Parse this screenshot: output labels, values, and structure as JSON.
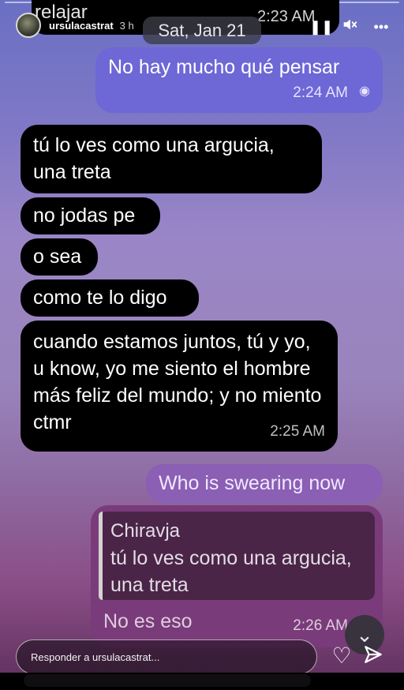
{
  "header": {
    "username": "ursulacastrat",
    "time_ago": "3 h",
    "controls": [
      {
        "icon": "pause-icon",
        "symbol": "❚❚"
      },
      {
        "icon": "mute-icon",
        "symbol": "🔇"
      },
      {
        "icon": "more-icon",
        "symbol": "•••"
      }
    ]
  },
  "chat": {
    "cutoff_top_text": "relajar",
    "cutoff_top_time": "2:23 AM",
    "date_pill": "Sat, Jan 21",
    "messages": [
      {
        "id": "m1",
        "direction": "out",
        "text": "No hay mucho qué pensar",
        "time": "2:24 AM",
        "status_icon": "read-check-icon"
      },
      {
        "id": "m2",
        "direction": "in",
        "text": "tú lo ves como una argucia, una treta"
      },
      {
        "id": "m3",
        "direction": "in",
        "text": "no jodas pe"
      },
      {
        "id": "m4",
        "direction": "in",
        "text": "o sea"
      },
      {
        "id": "m5",
        "direction": "in",
        "text": "como te lo digo"
      },
      {
        "id": "m6",
        "direction": "in",
        "text": "cuando estamos juntos, tú y yo, u know, yo me siento el hombre más feliz del mundo; y no miento ctmr",
        "time": "2:25 AM"
      },
      {
        "id": "m7",
        "direction": "out",
        "text": "Who is swearing now"
      },
      {
        "id": "m8",
        "direction": "out",
        "text": "No es eso",
        "time": "2:26 AM",
        "quote": {
          "name": "Chiravja",
          "text": "tú lo ves como una argucia, una treta"
        }
      }
    ]
  },
  "reply": {
    "placeholder": "Responder a ursulacastrat...",
    "heart_icon": "heart-icon",
    "send_icon": "send-icon"
  },
  "scroll_down_icon": "chevron-down-icon"
}
